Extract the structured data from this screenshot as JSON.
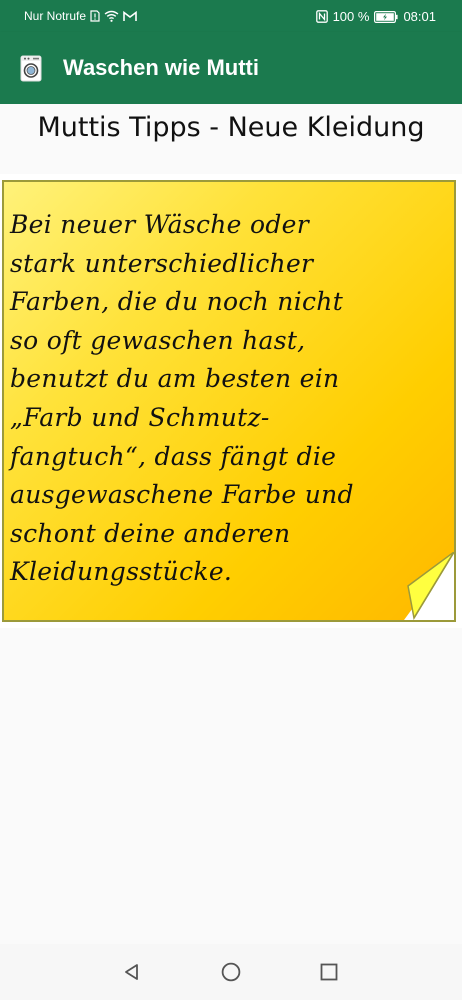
{
  "status_bar": {
    "carrier": "Nur Notrufe",
    "battery": "100 %",
    "time": "08:01",
    "icons": [
      "sim-alert-icon",
      "wifi-icon",
      "gmail-icon",
      "nfc-icon",
      "battery-icon"
    ]
  },
  "app_bar": {
    "title": "Waschen wie Mutti",
    "icon": "washing-machine-icon",
    "color": "#1b7a4e"
  },
  "main": {
    "title": "Muttis Tipps - Neue Kleidung",
    "note_text": "Bei neuer Wäsche oder\nstark unterschiedlicher\nFarben, die du noch nicht\nso oft gewaschen hast,\nbenutzt du am besten ein\n„Farb und Schmutz-\nfangtuch“, dass fängt die\nausgewaschene Farbe und\nschont deine anderen\nKleidungsstücke.",
    "note_color": "#ffd200"
  },
  "nav_bar": {
    "icons": [
      "back-icon",
      "home-icon",
      "recents-icon"
    ]
  }
}
